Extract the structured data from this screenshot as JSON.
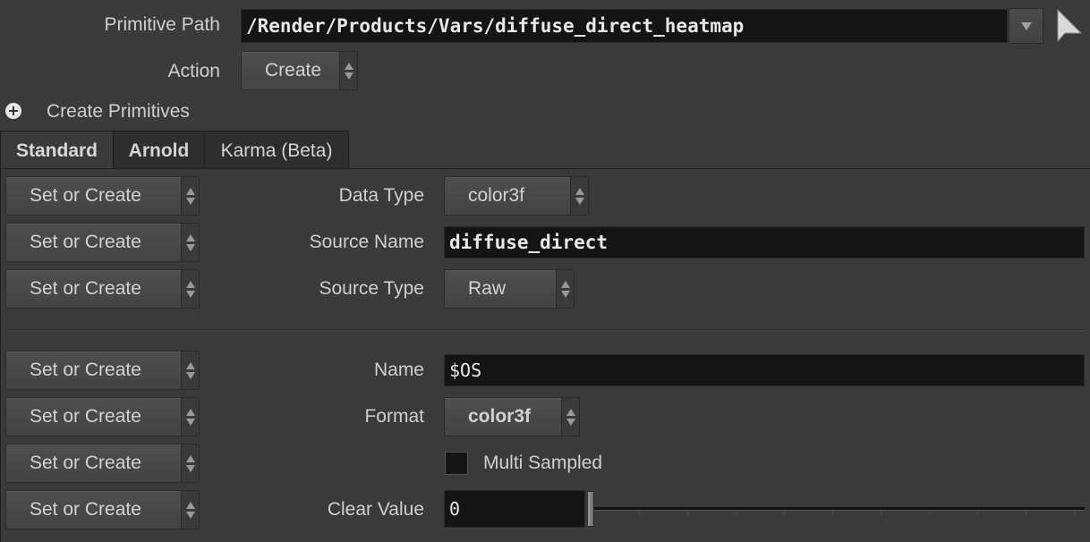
{
  "primitive_path": {
    "label": "Primitive Path",
    "value": "/Render/Products/Vars/diffuse_direct_heatmap"
  },
  "action": {
    "label": "Action",
    "value": "Create"
  },
  "create_primitives": {
    "label": "Create Primitives"
  },
  "tabs": [
    {
      "label": "Standard",
      "active": true
    },
    {
      "label": "Arnold",
      "active": false
    },
    {
      "label": "Karma (Beta)",
      "active": false
    }
  ],
  "rows": {
    "data_type": {
      "mode": "Set or Create",
      "label": "Data Type",
      "value": "color3f"
    },
    "source_name": {
      "mode": "Set or Create",
      "label": "Source Name",
      "value": "diffuse_direct"
    },
    "source_type": {
      "mode": "Set or Create",
      "label": "Source Type",
      "value": "Raw"
    },
    "name": {
      "mode": "Set or Create",
      "label": "Name",
      "value": "$OS"
    },
    "format": {
      "mode": "Set or Create",
      "label": "Format",
      "value": "color3f"
    },
    "multi_sampled": {
      "mode": "Set or Create",
      "label": "Multi Sampled",
      "checked": false
    },
    "clear_value": {
      "mode": "Set or Create",
      "label": "Clear Value",
      "value": "0",
      "slider_fraction": 0
    }
  },
  "icons": {
    "path_dropdown": "chevron-down-icon",
    "node_select": "select-arrow-icon",
    "expand": "plus-circle-icon"
  }
}
